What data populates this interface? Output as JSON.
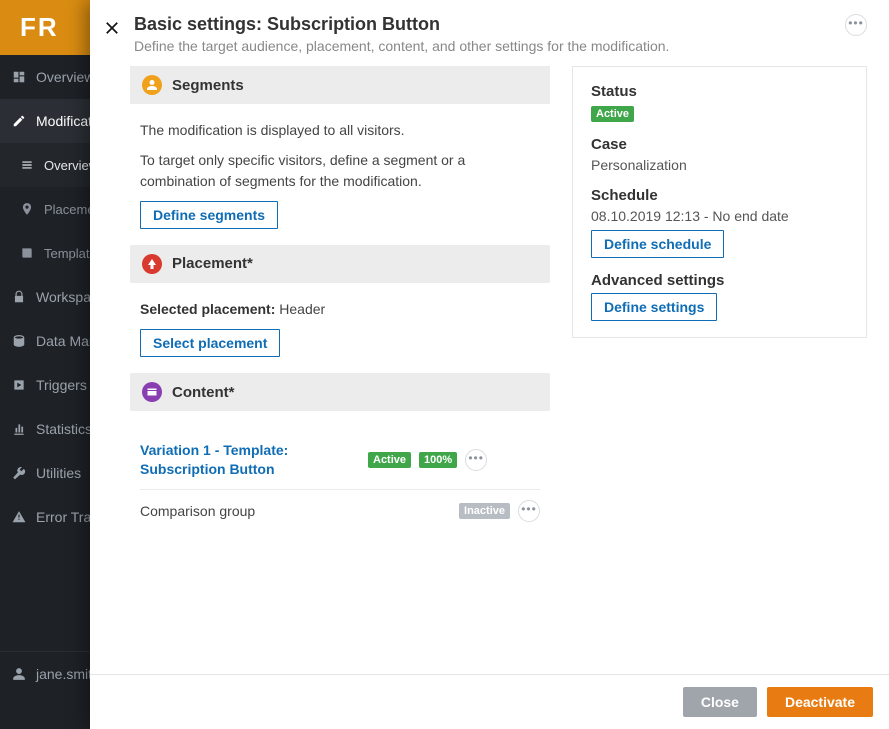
{
  "brand": "FR",
  "sidemenu": {
    "overview": "Overview",
    "modifications": "Modifications",
    "sub_overview": "Overview",
    "sub_placements": "Placements",
    "sub_templates": "Templates",
    "workspaces": "Workspaces",
    "data": "Data Management",
    "triggers": "Triggers",
    "statistics": "Statistics",
    "utilities": "Utilities",
    "error": "Error Tracking",
    "user": "jane.smith"
  },
  "modal": {
    "title": "Basic settings: Subscription Button",
    "subtitle": "Define the target audience, placement, content, and other settings for the modification."
  },
  "segments": {
    "heading": "Segments",
    "line1": "The modification is displayed to all visitors.",
    "line2": "To target only specific visitors, define a segment or a combination of segments for the modification.",
    "define_btn": "Define segments",
    "icon_color": "#f0a11c"
  },
  "placement": {
    "heading": "Placement*",
    "selected_label": "Selected placement:",
    "selected_value": "Header",
    "select_btn": "Select placement",
    "icon_color": "#d83a2f"
  },
  "content": {
    "heading": "Content*",
    "icon_color": "#8a3fb0",
    "variations": [
      {
        "label": "Variation 1 - Template: Subscription Button",
        "link": true,
        "active": "Active",
        "pct": "100%"
      },
      {
        "label": "Comparison group",
        "link": false,
        "inactive": "Inactive"
      }
    ]
  },
  "side": {
    "status_label": "Status",
    "status_value": "Active",
    "case_label": "Case",
    "case_value": "Personalization",
    "schedule_label": "Schedule",
    "schedule_value": "08.10.2019 12:13 - No end date",
    "schedule_btn": "Define schedule",
    "advanced_label": "Advanced settings",
    "advanced_btn": "Define settings"
  },
  "footer": {
    "close": "Close",
    "deactivate": "Deactivate"
  }
}
